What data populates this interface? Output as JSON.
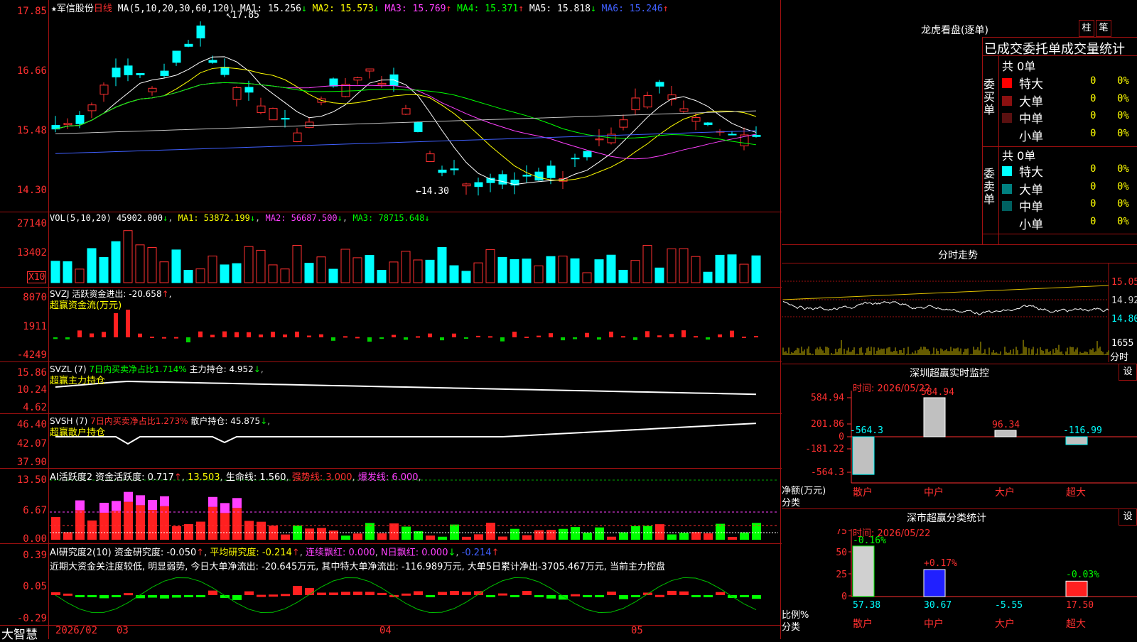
{
  "main": {
    "stock_name": "军信股份",
    "period": "日线",
    "ma_label": "MA(5,10,20,30,60,120)",
    "ma_values": [
      {
        "name": "MA1",
        "value": "15.256",
        "arrow": "↓",
        "color": "#ffffff"
      },
      {
        "name": "MA2",
        "value": "15.573",
        "arrow": "↓",
        "color": "#ffff00"
      },
      {
        "name": "MA3",
        "value": "15.769",
        "arrow": "↑",
        "color": "#ff40ff"
      },
      {
        "name": "MA4",
        "value": "15.371",
        "arrow": "↑",
        "color": "#00ff00"
      },
      {
        "name": "MA5",
        "value": "15.818",
        "arrow": "↓",
        "color": "#ffffff"
      },
      {
        "name": "MA6",
        "value": "15.246",
        "arrow": "↑",
        "color": "#4060ff"
      }
    ],
    "price_axis": [
      "17.85",
      "16.66",
      "15.48",
      "14.30"
    ],
    "high_label": "17.85",
    "low_label": "14.30"
  },
  "vol": {
    "header": "VOL(5,10,20)",
    "value": "45902.000",
    "ma1": "53872.199",
    "ma2": "56687.500",
    "ma3": "78715.648",
    "axis": [
      "27140",
      "13402"
    ],
    "unit": "X10"
  },
  "svzj": {
    "header": "SVZJ  活跃资金进出: -20.658",
    "sub": "超赢资金流(万元)",
    "axis": [
      "8070",
      "1911",
      "-4249"
    ]
  },
  "svzl": {
    "header": "SVZL (7)",
    "ratio": "7日内买卖净占比1.714%",
    "hold": "主力持仓: 4.952",
    "sub": "超赢主力持仓",
    "axis": [
      "15.86",
      "10.24",
      "4.62"
    ]
  },
  "svsh": {
    "header": "SVSH (7)",
    "ratio": "7日内买卖净占比1.273%",
    "hold": "散户持仓: 45.875",
    "sub": "超赢散户持仓",
    "axis": [
      "46.40",
      "42.07",
      "37.90"
    ]
  },
  "ai2": {
    "header": "AI活跃度2",
    "active": "资金活跃度: 0.717",
    "v2": "13.503",
    "life": "生命线: 1.560",
    "strong": "强势线: 3.000",
    "burst": "爆发线: 6.000",
    "axis": [
      "13.50",
      "6.67",
      "0.00"
    ]
  },
  "ai_res": {
    "header": "AI研究度2(10)",
    "research": "资金研究度: -0.050",
    "avg": "平均研究度: -0.214",
    "cont": "连续飘红: 0.000",
    "nday": "N日飘红: 0.000",
    "neg": "-0.214",
    "comment": "近期大资金关注度较低, 明显弱势, 今日大单净流出: -20.645万元, 其中特大单净流出: -116.989万元, 大单5日累计净出-3705.467万元, 当前主力控盘",
    "axis": [
      "0.39",
      "0.05",
      "-0.29"
    ]
  },
  "bottom": {
    "brand": "大智慧",
    "dates": [
      "2026/02",
      "03",
      "04",
      "05"
    ]
  },
  "right": {
    "lhb_title": "龙虎看盘(逐单)",
    "btn_zhu": "柱",
    "btn_bi": "笔",
    "stat_title": "已成交委托单成交量统计",
    "buy_label": "委买单",
    "sell_label": "委卖单",
    "buy_total": "共 0单",
    "sell_total": "共 0单",
    "buy_rows": [
      {
        "name": "特大",
        "count": "0",
        "pct": "0%",
        "color": "#ff0000"
      },
      {
        "name": "大单",
        "count": "0",
        "pct": "0%",
        "color": "#8b1010"
      },
      {
        "name": "中单",
        "count": "0",
        "pct": "0%",
        "color": "#5a1010"
      },
      {
        "name": "小单",
        "count": "0",
        "pct": "0%",
        "color": ""
      }
    ],
    "sell_rows": [
      {
        "name": "特大",
        "count": "0",
        "pct": "0%",
        "color": "#00ffff"
      },
      {
        "name": "大单",
        "count": "0",
        "pct": "0%",
        "color": "#008080"
      },
      {
        "name": "中单",
        "count": "0",
        "pct": "0%",
        "color": "#006060"
      },
      {
        "name": "小单",
        "count": "0",
        "pct": "0%",
        "color": ""
      }
    ],
    "intraday_title": "分时走势",
    "intraday_axis": [
      "15.05",
      "14.92",
      "14.80"
    ],
    "intraday_vol": "1655",
    "intraday_label": "分时",
    "monitor_title": "深圳超赢实时监控",
    "monitor_date": "时间: 2026/05/22",
    "monitor_btn": "设",
    "monitor_axis": [
      "584.94",
      "201.86",
      "0",
      "-181.22",
      "-564.3"
    ],
    "monitor_values": [
      "-564.3",
      "584.94",
      "96.34",
      "-116.99"
    ],
    "monitor_ylabel": "净额(万元)",
    "monitor_xlabel": "分类",
    "categories": [
      "散户",
      "中户",
      "大户",
      "超大"
    ],
    "class_title": "深市超赢分类统计",
    "class_date": "时间: 2026/05/22",
    "class_btn": "设",
    "class_axis": [
      "75",
      "50",
      "25",
      "0"
    ],
    "class_top": [
      "-0.16%",
      "+0.17%",
      "-0.03%"
    ],
    "class_values": [
      "57.38",
      "30.67",
      "-5.55",
      "17.50"
    ],
    "class_ylabel": "比例%",
    "class_xlabel": "分类"
  }
}
